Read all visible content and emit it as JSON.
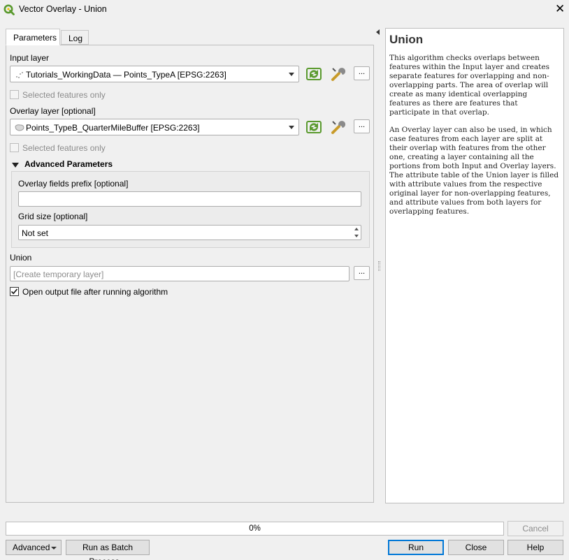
{
  "window": {
    "title": "Vector Overlay - Union",
    "close_glyph": "✕"
  },
  "tabs": [
    {
      "label": "Parameters",
      "active": true
    },
    {
      "label": "Log",
      "active": false
    }
  ],
  "params": {
    "input_layer": {
      "label": "Input layer",
      "value": "Tutorials_WorkingData — Points_TypeA [EPSG:2263]",
      "icon": "point-layer-icon",
      "selected_only_label": "Selected features only",
      "selected_only_checked": false
    },
    "overlay_layer": {
      "label": "Overlay layer [optional]",
      "value": "Points_TypeB_QuarterMileBuffer [EPSG:2263]",
      "icon": "polygon-layer-icon",
      "selected_only_label": "Selected features only",
      "selected_only_checked": false
    },
    "dots_label": "...",
    "advanced": {
      "header": "Advanced Parameters",
      "overlay_prefix_label": "Overlay fields prefix [optional]",
      "overlay_prefix_value": "",
      "grid_size_label": "Grid size [optional]",
      "grid_size_value": "Not set"
    },
    "output": {
      "label": "Union",
      "placeholder": "[Create temporary layer]",
      "open_after_label": "Open output file after running algorithm",
      "open_after_checked": true
    }
  },
  "help": {
    "title": "Union",
    "paragraphs": [
      "This algorithm checks overlaps between features within the Input layer and creates separate features for overlapping and non-overlapping parts. The area of overlap will create as many identical overlapping features as there are features that participate in that overlap.",
      "An Overlay layer can also be used, in which case features from each layer are split at their overlap with features from the other one, creating a layer containing all the portions from both Input and Overlay layers. The attribute table of the Union layer is filled with attribute values from the respective original layer for non-overlapping features, and attribute values from both layers for overlapping features."
    ]
  },
  "progress": {
    "value": 0,
    "text": "0%"
  },
  "buttons": {
    "cancel": "Cancel",
    "advanced": "Advanced",
    "batch": "Run as Batch Process...",
    "run": "Run",
    "close": "Close",
    "help": "Help"
  },
  "colors": {
    "accent": "#0078d7",
    "qgis_green": "#5a9a2e",
    "progress_fill": "#06b025"
  }
}
